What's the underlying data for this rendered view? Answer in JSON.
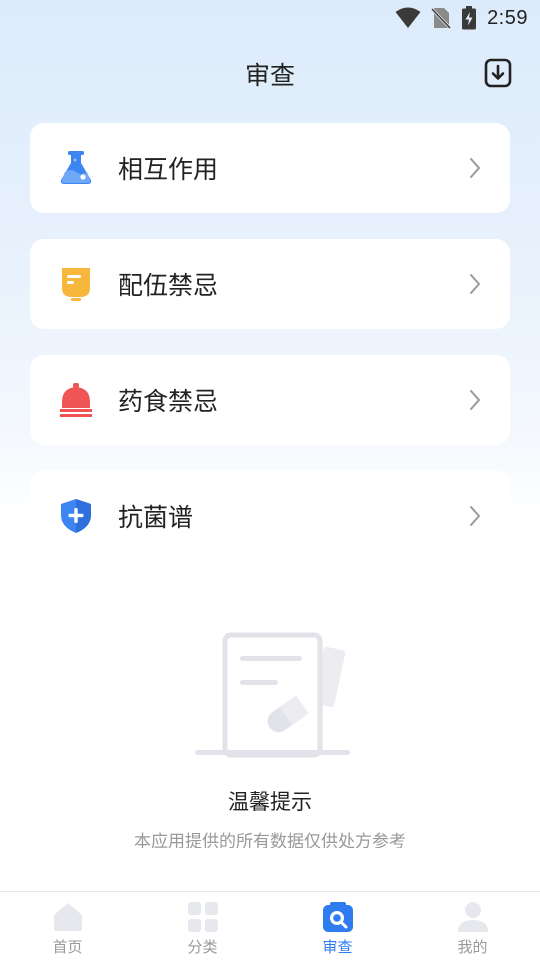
{
  "status_bar": {
    "time": "2:59"
  },
  "header": {
    "title": "审查"
  },
  "cards": [
    {
      "label": "相互作用",
      "icon": "flask-icon"
    },
    {
      "label": "配伍禁忌",
      "icon": "bottle-icon"
    },
    {
      "label": "药食禁忌",
      "icon": "bell-icon"
    },
    {
      "label": "抗菌谱",
      "icon": "shield-plus-icon"
    }
  ],
  "notice": {
    "title": "温馨提示",
    "description": "本应用提供的所有数据仅供处方参考"
  },
  "bottom_nav": {
    "active": "审查",
    "items": [
      {
        "label": "首页",
        "icon": "home-icon"
      },
      {
        "label": "分类",
        "icon": "grid-icon"
      },
      {
        "label": "审查",
        "icon": "review-icon"
      },
      {
        "label": "我的",
        "icon": "user-icon"
      }
    ]
  },
  "colors": {
    "accent": "#2f7bf0",
    "flask": "#3d86f2",
    "bottle": "#f6b73c",
    "bell": "#f05555",
    "shield": "#3d86f2"
  }
}
